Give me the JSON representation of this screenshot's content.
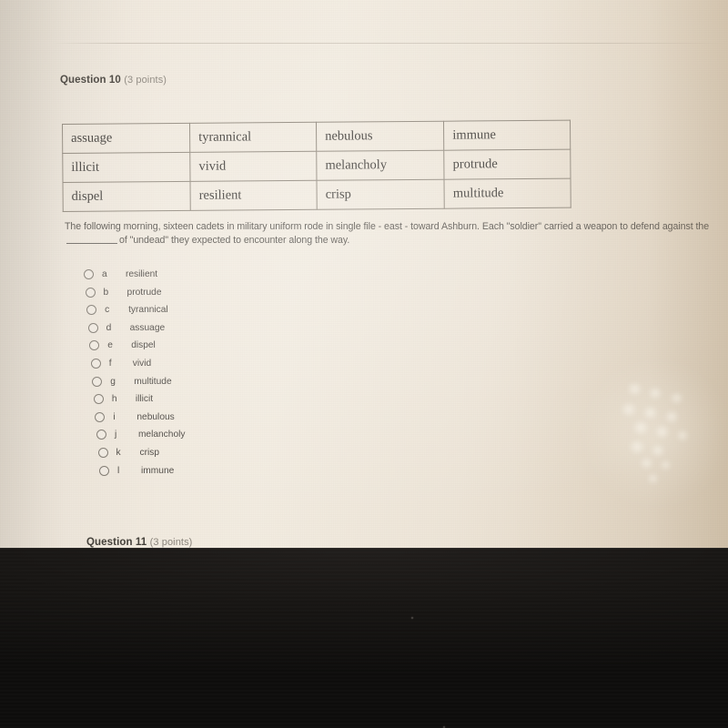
{
  "question": {
    "heading_label": "Question 10",
    "heading_points": "(3 points)",
    "stem_part1": "The following morning, sixteen cadets in military uniform rode in single file - east - toward Ashburn. Each \"soldier\" carried a weapon to defend against the",
    "stem_part2": "of \"undead\" they expected to encounter along the way."
  },
  "word_bank": {
    "rows": [
      [
        "assuage",
        "tyrannical",
        "nebulous",
        "immune"
      ],
      [
        "illicit",
        "vivid",
        "melancholy",
        "protrude"
      ],
      [
        "dispel",
        "resilient",
        "crisp",
        "multitude"
      ]
    ]
  },
  "options": [
    {
      "letter": "a",
      "word": "resilient"
    },
    {
      "letter": "b",
      "word": "protrude"
    },
    {
      "letter": "c",
      "word": "tyrannical"
    },
    {
      "letter": "d",
      "word": "assuage"
    },
    {
      "letter": "e",
      "word": "dispel"
    },
    {
      "letter": "f",
      "word": "vivid"
    },
    {
      "letter": "g",
      "word": "multitude"
    },
    {
      "letter": "h",
      "word": "illicit"
    },
    {
      "letter": "i",
      "word": "nebulous"
    },
    {
      "letter": "j",
      "word": "melancholy"
    },
    {
      "letter": "k",
      "word": "crisp"
    },
    {
      "letter": "l",
      "word": "immune"
    }
  ],
  "next_question": {
    "heading_label": "Question 11",
    "heading_points": "(3 points)"
  },
  "colors": {
    "page_background": "#f2ebe0",
    "heading_text": "#433f39",
    "body_text": "#55514b",
    "table_border": "#8e867a",
    "bezel": "#171513"
  }
}
